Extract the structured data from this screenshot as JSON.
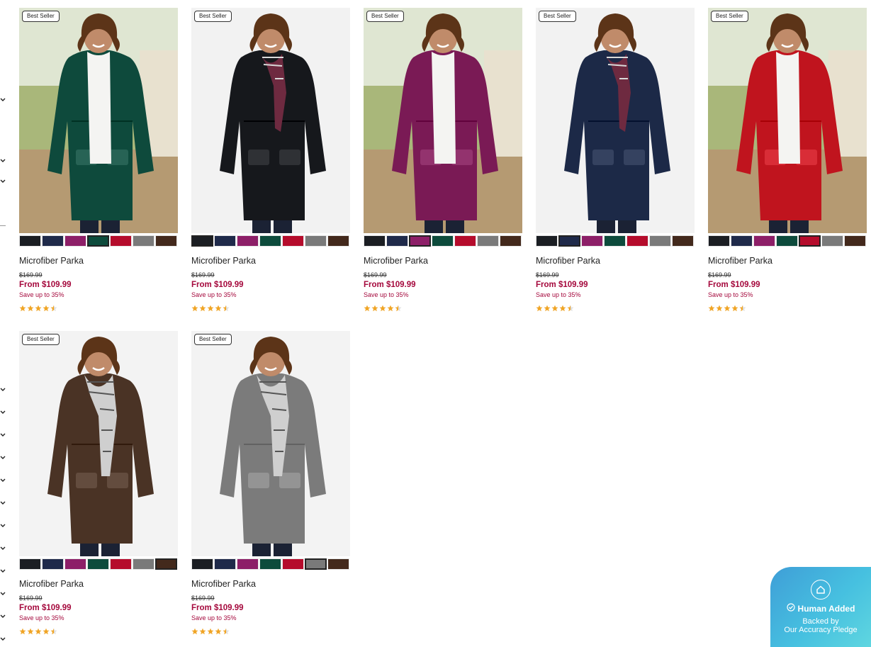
{
  "colors": {
    "price_red": "#a5093d",
    "star_gold": "#f0a526",
    "pledge_bg": "#46c0e0",
    "swatches": [
      "#1b1e23",
      "#1f2a4a",
      "#8d1f68",
      "#0d4b3c",
      "#b50c2c",
      "#7a7a7a",
      "#43291c"
    ]
  },
  "products": [
    {
      "badge": "Best Seller",
      "title": "Microfiber Parka",
      "was": "$169.99",
      "now": "From $109.99",
      "save": "Save up to 35%",
      "rating": 4.5,
      "jacket_color": "#0e4a3c",
      "bg": "#d9d1b7",
      "scarf": "none",
      "selected_swatch": 3
    },
    {
      "badge": "Best Seller",
      "title": "Microfiber Parka",
      "was": "$169.99",
      "now": "From $109.99",
      "save": "Save up to 35%",
      "rating": 4.5,
      "jacket_color": "#16181c",
      "bg": "#f2f2f2",
      "scarf": "plaid",
      "selected_swatch": 0
    },
    {
      "badge": "Best Seller",
      "title": "Microfiber Parka",
      "was": "$169.99",
      "now": "From $109.99",
      "save": "Save up to 35%",
      "rating": 4.5,
      "jacket_color": "#7a1a55",
      "bg": "#d8d3b9",
      "scarf": "none",
      "selected_swatch": 2
    },
    {
      "badge": "Best Seller",
      "title": "Microfiber Parka",
      "was": "$169.99",
      "now": "From $109.99",
      "save": "Save up to 35%",
      "rating": 4.5,
      "jacket_color": "#1c2947",
      "bg": "#f2f2f2",
      "scarf": "plaid",
      "selected_swatch": 1
    },
    {
      "badge": "Best Seller",
      "title": "Microfiber Parka",
      "was": "$169.99",
      "now": "From $109.99",
      "save": "Save up to 35%",
      "rating": 4.5,
      "jacket_color": "#c0141e",
      "bg": "#d7d0b6",
      "scarf": "none",
      "selected_swatch": 4
    },
    {
      "badge": "Best Seller",
      "title": "Microfiber Parka",
      "was": "$169.99",
      "now": "From $109.99",
      "save": "Save up to 35%",
      "rating": 4.5,
      "jacket_color": "#4a3325",
      "bg": "#f3f3f3",
      "scarf": "knit",
      "selected_swatch": 6
    },
    {
      "badge": "Best Seller",
      "title": "Microfiber Parka",
      "was": "$169.99",
      "now": "From $109.99",
      "save": "Save up to 35%",
      "rating": 4.5,
      "jacket_color": "#7b7b7b",
      "bg": "#f3f3f3",
      "scarf": "knit",
      "selected_swatch": 5
    }
  ],
  "pledge": {
    "headline": "Human Added",
    "line1": "Backed by",
    "line2": "Our Accuracy Pledge"
  }
}
